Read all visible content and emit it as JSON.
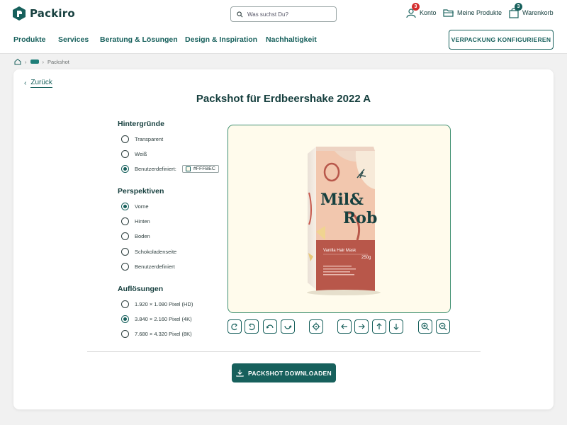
{
  "brand": {
    "name": "Packiro"
  },
  "search": {
    "placeholder": "Was suchst Du?"
  },
  "utility": {
    "account": {
      "label": "Konto",
      "badge": "3"
    },
    "products": {
      "label": "Meine Produkte"
    },
    "cart": {
      "label": "Warenkorb",
      "badge": "3"
    }
  },
  "nav": {
    "items": [
      "Produkte",
      "Services",
      "Beratung & Lösungen",
      "Design & Inspiration",
      "Nachhaltigkeit"
    ],
    "cta": "VERPACKUNG KONFIGURIEREN"
  },
  "breadcrumb": {
    "current": "Packshot"
  },
  "page": {
    "back": "Zurück",
    "title": "Packshot für Erdbeershake 2022 A"
  },
  "backgrounds": {
    "title": "Hintergründe",
    "options": [
      "Transparent",
      "Weiß",
      "Benutzerdefiniert:"
    ],
    "selected": 2,
    "custom_color": "#FFFBEC"
  },
  "perspectives": {
    "title": "Perspektiven",
    "options": [
      "Vorne",
      "Hinten",
      "Boden",
      "Schokoladenseite",
      "Benutzerdefiniert"
    ],
    "selected": 0
  },
  "resolutions": {
    "title": "Auflösungen",
    "options": [
      "1.920 × 1.080 Pixel (HD)",
      "3.840 × 2.160 Pixel (4K)",
      "7.680 × 4.320 Pixel (8K)"
    ],
    "selected": 1
  },
  "product": {
    "brand_line1": "Mil&",
    "brand_line2": "Rob",
    "variant": "Vanilla Hair Mask",
    "weight": "250g"
  },
  "controls": [
    "rotate-left-icon",
    "rotate-right-icon",
    "tilt-forward-icon",
    "tilt-back-icon",
    "center-icon",
    "arrow-left-icon",
    "arrow-right-icon",
    "arrow-up-icon",
    "arrow-down-icon",
    "zoom-in-icon",
    "zoom-out-icon"
  ],
  "download": {
    "label": "PACKSHOT DOWNLOADEN"
  },
  "colors": {
    "primary": "#17605C",
    "accent_border": "#3E8F6F",
    "badge": "#D42E2E",
    "badge_cart": "#17605C",
    "preview_bg": "#FFFBEC",
    "pouch_top": "#F2C7AE",
    "pouch_bottom": "#B8574A"
  }
}
